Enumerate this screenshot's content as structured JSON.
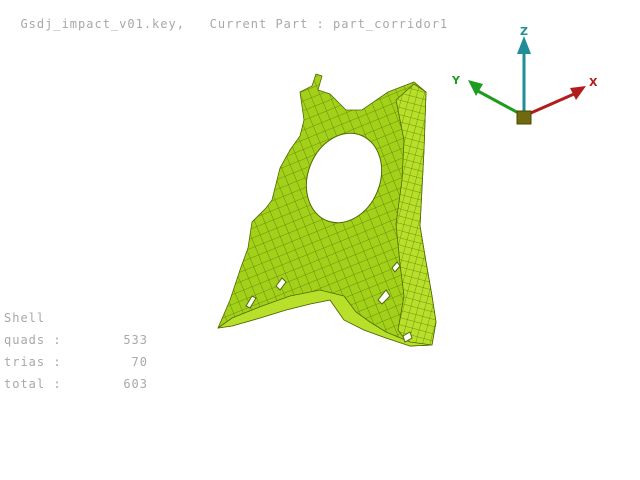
{
  "header": {
    "file": "Gsdj_impact_v01.key,",
    "part": "Current Part : part_corridor1"
  },
  "stats": {
    "title": "Shell",
    "rows": [
      {
        "label": "quads :",
        "value": "533"
      },
      {
        "label": "trias :",
        "value": "70"
      },
      {
        "label": "total :",
        "value": "603"
      }
    ]
  },
  "triad": {
    "x_label": "X",
    "y_label": "Y",
    "z_label": "Z",
    "x_color": "#b11d1d",
    "y_color": "#1e9b21",
    "z_color": "#1f8e98"
  },
  "model": {
    "fill": "#9ccc14",
    "mesh": "#4d6b00"
  }
}
